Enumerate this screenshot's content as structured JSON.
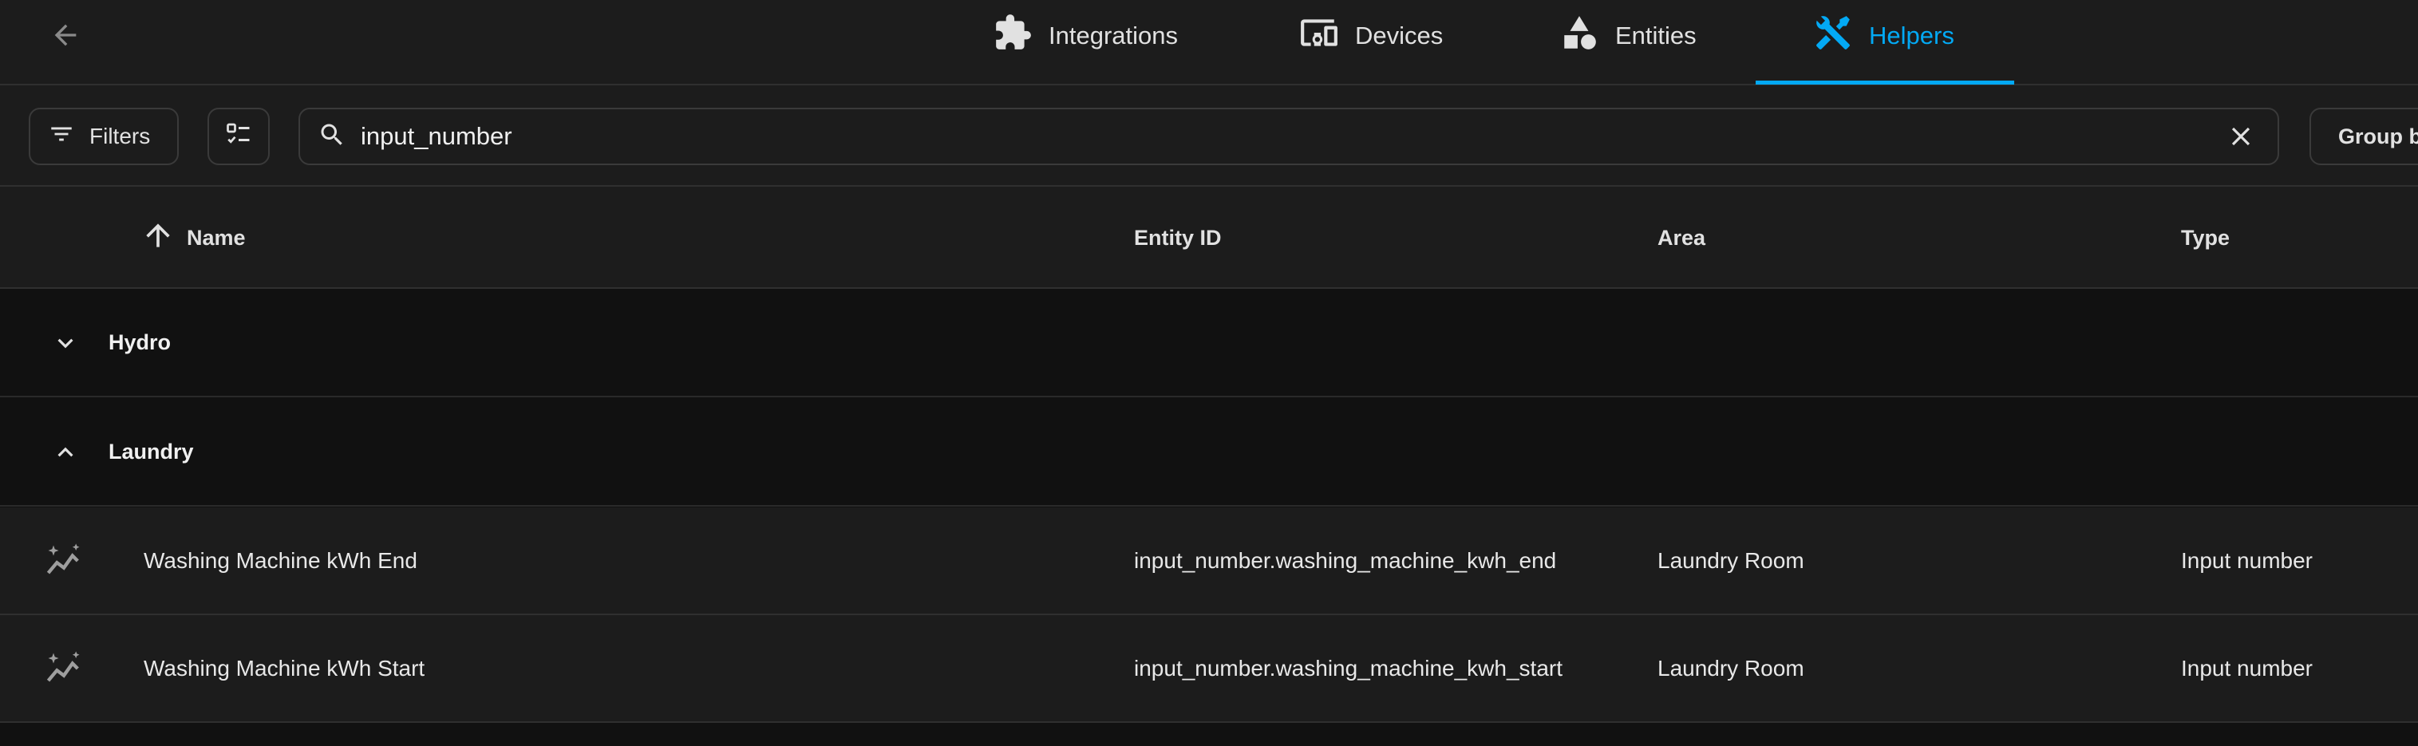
{
  "nav": {
    "back_icon": "arrow-left-icon",
    "tabs": [
      {
        "label": "Integrations",
        "icon": "puzzle-icon",
        "active": false
      },
      {
        "label": "Devices",
        "icon": "devices-icon",
        "active": false
      },
      {
        "label": "Entities",
        "icon": "shapes-icon",
        "active": false
      },
      {
        "label": "Helpers",
        "icon": "tools-icon",
        "active": true
      }
    ]
  },
  "toolbar": {
    "filters_label": "Filters",
    "search_value": "input_number",
    "group_by_label": "Group by"
  },
  "table": {
    "columns": {
      "name": "Name",
      "entity_id": "Entity ID",
      "area": "Area",
      "type": "Type"
    },
    "sort": {
      "column": "name",
      "direction": "ascending"
    },
    "groups": [
      {
        "label": "Hydro",
        "expanded": false
      },
      {
        "label": "Laundry",
        "expanded": true
      }
    ],
    "rows": [
      {
        "icon": "chart-sparkle-icon",
        "name": "Washing Machine kWh End",
        "entity_id": "input_number.washing_machine_kwh_end",
        "area": "Laundry Room",
        "type": "Input number"
      },
      {
        "icon": "chart-sparkle-icon",
        "name": "Washing Machine kWh Start",
        "entity_id": "input_number.washing_machine_kwh_start",
        "area": "Laundry Room",
        "type": "Input number"
      }
    ]
  },
  "colors": {
    "accent": "#03a9f4",
    "background": "#111111",
    "surface": "#1c1c1c",
    "divider": "#2f2f2f",
    "text": "#e1e1e1"
  }
}
